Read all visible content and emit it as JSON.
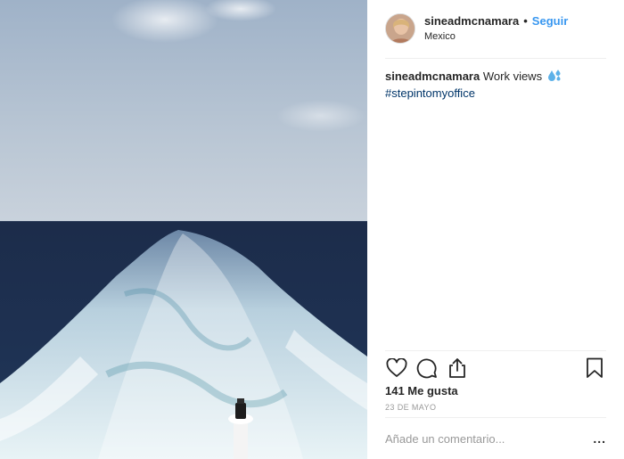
{
  "post": {
    "username": "sineadmcnamara",
    "separator": "•",
    "follow_label": "Seguir",
    "location": "Mexico",
    "caption_username": "sineadmcnamara",
    "caption_text": "Work views",
    "caption_emoji_icon": "sweat-droplets-icon",
    "hashtag": "#stepintomyoffice",
    "likes": "141 Me gusta",
    "date": "23 DE MAYO",
    "comment_placeholder": "Añade un comentario...",
    "more_label": "..."
  },
  "icons": {
    "like": "heart-icon",
    "comment": "comment-icon",
    "share": "share-icon",
    "save": "bookmark-icon",
    "more": "more-options-icon"
  },
  "colors": {
    "link": "#3897f0",
    "hashtag": "#003569",
    "text": "#262626",
    "muted": "#999999",
    "divider": "#efefef"
  }
}
